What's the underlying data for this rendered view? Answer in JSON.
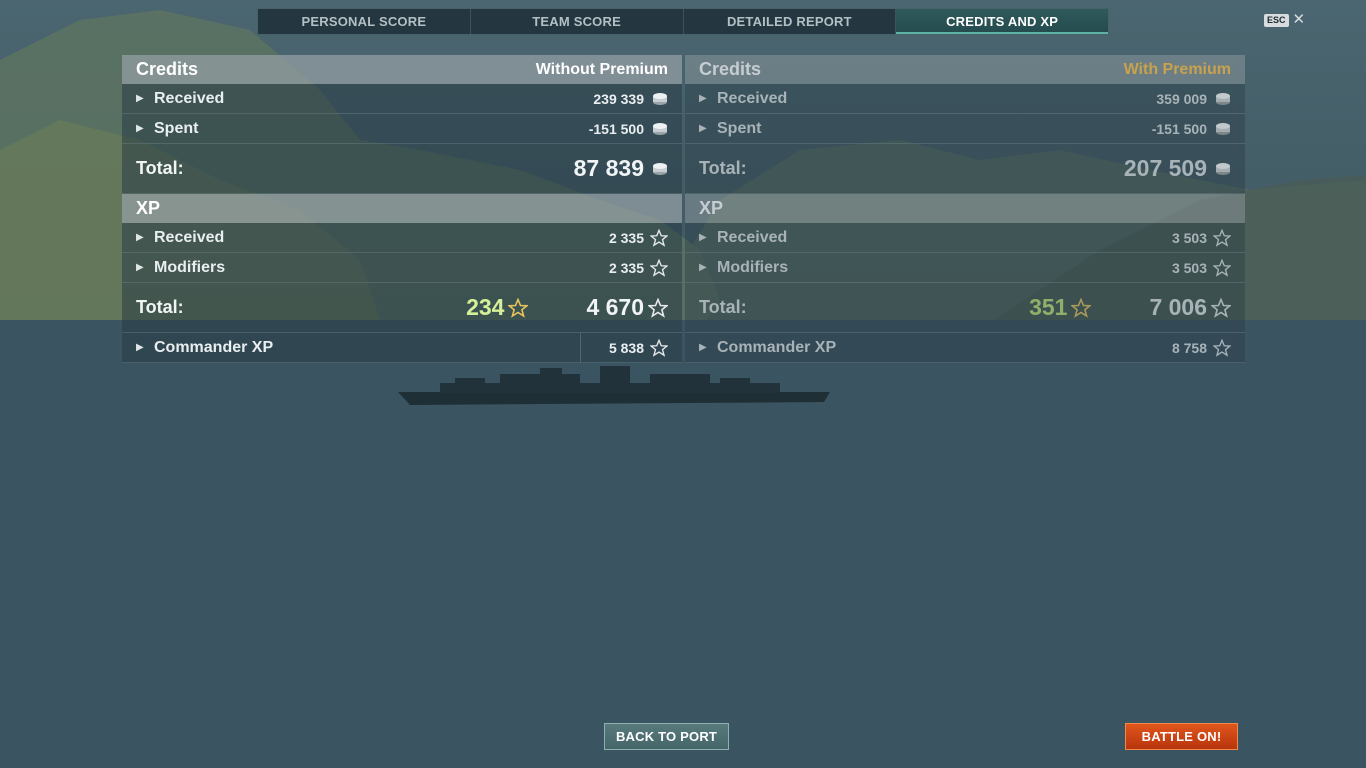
{
  "tabs": [
    {
      "label": "PERSONAL SCORE"
    },
    {
      "label": "TEAM SCORE"
    },
    {
      "label": "DETAILED REPORT"
    },
    {
      "label": "CREDITS AND XP",
      "active": true
    }
  ],
  "esc": {
    "key_label": "ESC",
    "close_glyph": "✕"
  },
  "without_premium": {
    "credits": {
      "title": "Credits",
      "note": "Without Premium",
      "received_label": "Received",
      "received_value": "239 339",
      "spent_label": "Spent",
      "spent_value": "-151 500",
      "total_label": "Total:",
      "total_value": "87 839"
    },
    "xp": {
      "title": "XP",
      "received_label": "Received",
      "received_value": "2 335",
      "modifiers_label": "Modifiers",
      "modifiers_value": "2 335",
      "total_label": "Total:",
      "bonus_value": "234",
      "total_value": "4 670"
    },
    "commander": {
      "label": "Commander XP",
      "value": "5 838"
    }
  },
  "with_premium": {
    "credits": {
      "title": "Credits",
      "note": "With Premium",
      "received_label": "Received",
      "received_value": "359 009",
      "spent_label": "Spent",
      "spent_value": "-151 500",
      "total_label": "Total:",
      "total_value": "207 509"
    },
    "xp": {
      "title": "XP",
      "received_label": "Received",
      "received_value": "3 503",
      "modifiers_label": "Modifiers",
      "modifiers_value": "3 503",
      "total_label": "Total:",
      "bonus_value": "351",
      "total_value": "7 006"
    },
    "commander": {
      "label": "Commander XP",
      "value": "8 758"
    }
  },
  "icons": {
    "credits": "credits-coin-icon",
    "xp": "xp-star-icon",
    "expand": "expand-arrow-icon"
  },
  "colors": {
    "premium_accent": "#c9a24d",
    "bonus_xp": "#d6f09a",
    "battle_button": "#d4461a",
    "active_tab": "#2f5a5c"
  },
  "buttons": {
    "back_to_port": "BACK TO PORT",
    "battle_on": "BATTLE ON!"
  }
}
